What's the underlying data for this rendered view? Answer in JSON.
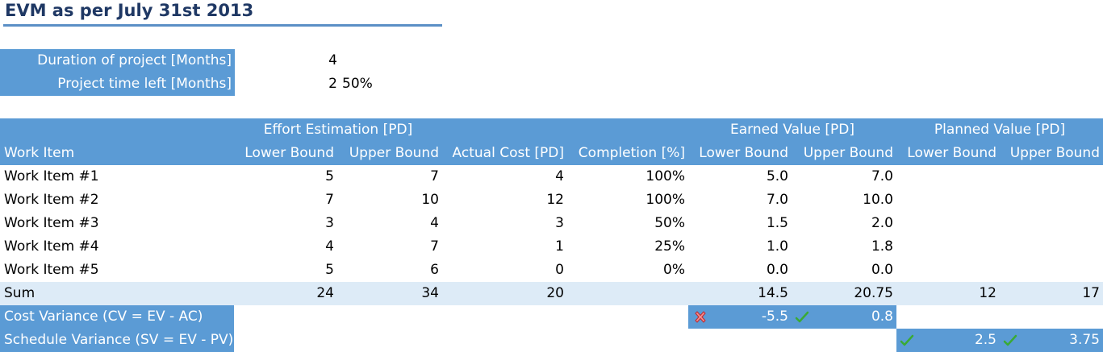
{
  "title": "EVM as per July 31st 2013",
  "info": {
    "duration_label": "Duration of project [Months]",
    "duration_value": "4",
    "timeleft_label": "Project time left [Months]",
    "timeleft_value": "2",
    "timeleft_pct": "50%"
  },
  "table": {
    "group_headers": {
      "effort": "Effort Estimation [PD]",
      "earned": "Earned Value [PD]",
      "planned": "Planned Value [PD]"
    },
    "columns": [
      "Work Item",
      "Lower Bound",
      "Upper Bound",
      "Actual Cost [PD]",
      "Completion [%]",
      "Lower Bound",
      "Upper Bound",
      "Lower Bound",
      "Upper Bound"
    ],
    "rows": [
      {
        "name": "Work Item #1",
        "lb": "5",
        "ub": "7",
        "ac": "4",
        "comp": "100%",
        "ev_lb": "5.0",
        "ev_ub": "7.0"
      },
      {
        "name": "Work Item #2",
        "lb": "7",
        "ub": "10",
        "ac": "12",
        "comp": "100%",
        "ev_lb": "7.0",
        "ev_ub": "10.0"
      },
      {
        "name": "Work Item #3",
        "lb": "3",
        "ub": "4",
        "ac": "3",
        "comp": "50%",
        "ev_lb": "1.5",
        "ev_ub": "2.0"
      },
      {
        "name": "Work Item #4",
        "lb": "4",
        "ub": "7",
        "ac": "1",
        "comp": "25%",
        "ev_lb": "1.0",
        "ev_ub": "1.8"
      },
      {
        "name": "Work Item #5",
        "lb": "5",
        "ub": "6",
        "ac": "0",
        "comp": "0%",
        "ev_lb": "0.0",
        "ev_ub": "0.0"
      }
    ],
    "sum": {
      "label": "Sum",
      "lb": "24",
      "ub": "34",
      "ac": "20",
      "ev_lb": "14.5",
      "ev_ub": "20.75",
      "pv_lb": "12",
      "pv_ub": "17"
    },
    "cv": {
      "label": "Cost Variance (CV = EV - AC)",
      "lb": "-5.5",
      "ub": "0.8",
      "lb_icon": "red-x-icon",
      "ub_icon": "green-check-icon"
    },
    "sv": {
      "label": "Schedule Variance (SV = EV - PV)",
      "lb": "2.5",
      "ub": "3.75",
      "lb_icon": "green-check-icon",
      "ub_icon": "green-check-icon"
    }
  },
  "colors": {
    "header_bg": "#5b9bd5",
    "sum_bg": "#ddebf7",
    "title_underline": "#5b8fc6",
    "check": "#3aaa35",
    "cross": "#e0343a"
  }
}
